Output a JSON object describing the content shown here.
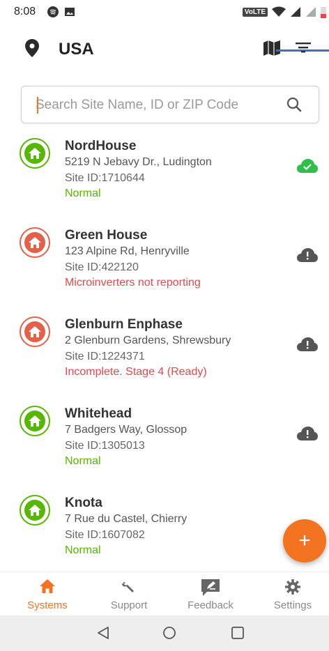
{
  "status_bar": {
    "time": "8:08",
    "network_badge": "VoLTE"
  },
  "header": {
    "title": "USA",
    "location_icon": "location-pin-icon",
    "map_icon": "map-icon",
    "menu_icon": "filter-menu-icon"
  },
  "search": {
    "placeholder": "Search Site Name, ID or ZIP Code",
    "value": ""
  },
  "sites": [
    {
      "name": "NordHouse",
      "address": "5219 N Jebavy Dr., Ludington",
      "site_id": "Site ID:1710644",
      "status": "Normal",
      "state": "ok"
    },
    {
      "name": "Green House",
      "address": "123 Alpine Rd, Henryville",
      "site_id": "Site ID:422120",
      "status": "Microinverters not reporting",
      "state": "error"
    },
    {
      "name": "Glenburn Enphase",
      "address": "2 Glenburn Gardens, Shrewsbury",
      "site_id": "Site ID:1224371",
      "status": "Incomplete. Stage 4 (Ready)",
      "state": "error"
    },
    {
      "name": "Whitehead",
      "address": "7 Badgers Way, Glossop",
      "site_id": "Site ID:1305013",
      "status": "Normal",
      "state": "ok"
    },
    {
      "name": "Knota",
      "address": "7 Rue du Castel, Chierry",
      "site_id": "Site ID:1607082",
      "status": "Normal",
      "state": "ok"
    }
  ],
  "fab": {
    "label": "+"
  },
  "bottom_nav": [
    {
      "label": "Systems",
      "icon": "home-icon",
      "active": true
    },
    {
      "label": "Support",
      "icon": "wrench-icon",
      "active": false
    },
    {
      "label": "Feedback",
      "icon": "feedback-icon",
      "active": false
    },
    {
      "label": "Settings",
      "icon": "gear-icon",
      "active": false
    }
  ],
  "colors": {
    "accent": "#f37321",
    "ok_green": "#57b600",
    "error_red": "#e5484d",
    "cloud_ok": "#2fbf4a",
    "cloud_unknown": "#555555"
  }
}
